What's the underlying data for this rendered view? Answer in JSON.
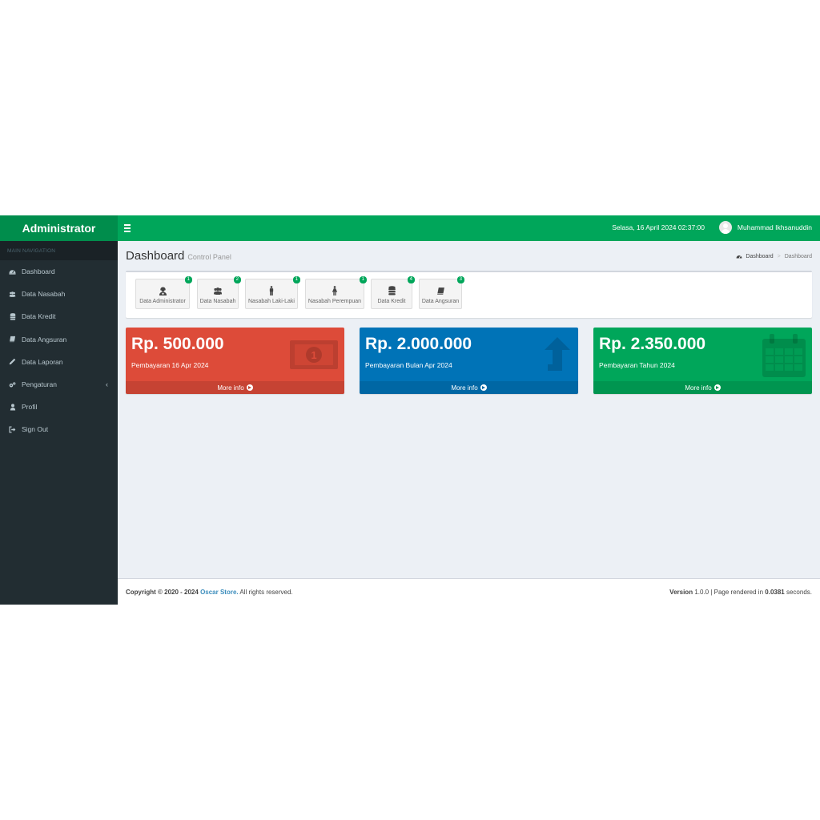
{
  "header": {
    "logo": "Administrator",
    "datetime": "Selasa, 16 April 2024 02:37:00",
    "user_name": "Muhammad Ikhsanuddin"
  },
  "sidebar": {
    "header": "MAIN NAVIGATION",
    "items": [
      {
        "label": "Dashboard",
        "icon": "dashboard-icon"
      },
      {
        "label": "Data Nasabah",
        "icon": "users-icon"
      },
      {
        "label": "Data Kredit",
        "icon": "database-icon"
      },
      {
        "label": "Data Angsuran",
        "icon": "book-icon"
      },
      {
        "label": "Data Laporan",
        "icon": "pencil-icon"
      },
      {
        "label": "Pengaturan",
        "icon": "cogs-icon"
      },
      {
        "label": "Profil",
        "icon": "user-icon"
      },
      {
        "label": "Sign Out",
        "icon": "sign-out-icon"
      }
    ]
  },
  "page": {
    "title": "Dashboard",
    "subtitle": "Control Panel",
    "breadcrumb": [
      "Dashboard",
      "Dashboard"
    ]
  },
  "shortcuts": [
    {
      "label": "Data Administrator",
      "badge": "1",
      "icon": "admin-icon"
    },
    {
      "label": "Data Nasabah",
      "badge": "2",
      "icon": "users-icon"
    },
    {
      "label": "Nasabah Laki-Laki",
      "badge": "1",
      "icon": "male-icon"
    },
    {
      "label": "Nasabah Perempuan",
      "badge": "1",
      "icon": "female-icon"
    },
    {
      "label": "Data Kredit",
      "badge": "4",
      "icon": "database-icon"
    },
    {
      "label": "Data Angsuran",
      "badge": "3",
      "icon": "book-icon"
    }
  ],
  "stats": [
    {
      "amount": "Rp. 500.000",
      "label": "Pembayaran 16 Apr 2024",
      "more": "More info",
      "color": "#dd4b39",
      "icon": "money-icon"
    },
    {
      "amount": "Rp. 2.000.000",
      "label": "Pembayaran Bulan Apr 2024",
      "more": "More info",
      "color": "#0073b7",
      "icon": "level-up-icon"
    },
    {
      "amount": "Rp. 2.350.000",
      "label": "Pembayaran Tahun 2024",
      "more": "More info",
      "color": "#00a65a",
      "icon": "calendar-icon"
    }
  ],
  "footer": {
    "copyright": "Copyright © 2020 - 2024",
    "store": "Oscar Store.",
    "rights": "All rights reserved.",
    "version_label": "Version",
    "version": "1.0.0",
    "rendered_prefix": "| Page rendered in",
    "rendered_time": "0.0381",
    "rendered_suffix": "seconds."
  }
}
